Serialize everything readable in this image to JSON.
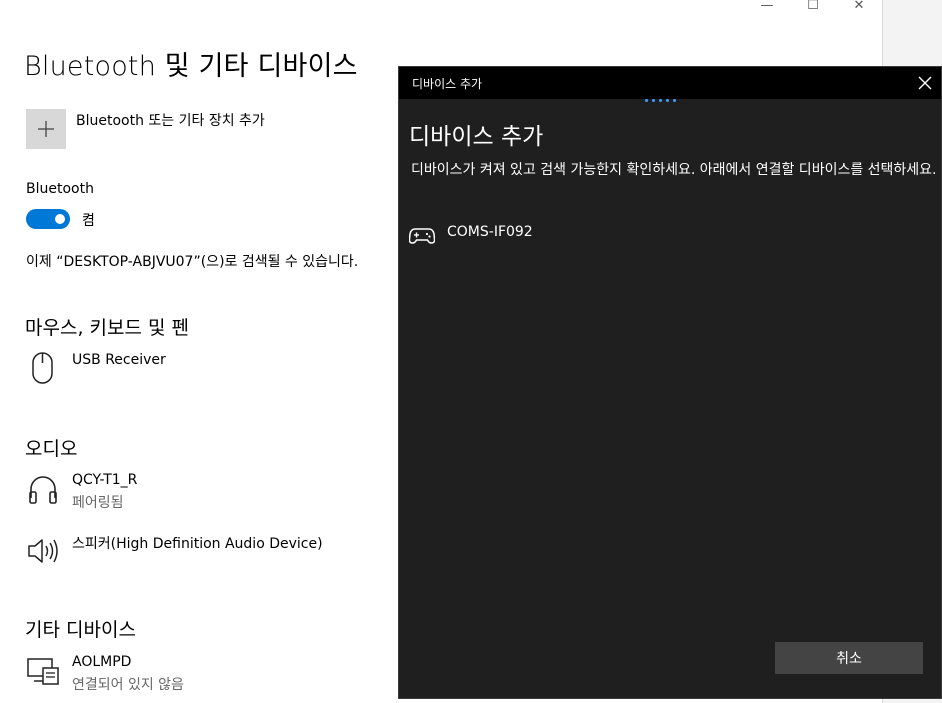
{
  "window": {
    "minimize_glyph": "—",
    "maximize_glyph": "☐",
    "close_glyph": "✕"
  },
  "settings": {
    "title": "Bluetooth 및 기타 디바이스",
    "add_device_label": "Bluetooth 또는 기타 장치 추가",
    "bluetooth_section": "Bluetooth",
    "toggle_state": "켬",
    "discoverable_text": "이제 “DESKTOP-ABJVU07”(으)로 검색될 수 있습니다.",
    "sections": {
      "input": {
        "heading": "마우스, 키보드 및 펜",
        "devices": [
          {
            "name": "USB Receiver",
            "icon": "mouse-icon"
          }
        ]
      },
      "audio": {
        "heading": "오디오",
        "devices": [
          {
            "name": "QCY-T1_R",
            "status": "페어링됨",
            "icon": "headphones-icon"
          },
          {
            "name": "스피커(High Definition Audio Device)",
            "icon": "speaker-icon"
          }
        ]
      },
      "other": {
        "heading": "기타 디바이스",
        "devices": [
          {
            "name": "AOLMPD",
            "status": "연결되어 있지 않음",
            "icon": "display-icon"
          }
        ]
      }
    }
  },
  "dialog": {
    "window_title": "디바이스 추가",
    "heading": "디바이스 추가",
    "description": "디바이스가 켜져 있고 검색 가능한지 확인하세요. 아래에서 연결할 디바이스를 선택하세요.",
    "devices": [
      {
        "name": "COMS-IF092",
        "icon": "gamepad-icon"
      }
    ],
    "cancel_label": "취소"
  },
  "colors": {
    "accent": "#0078d7",
    "dialog_bg": "#1f1f1f",
    "dialog_titlebar": "#000000",
    "button_bg": "#444444"
  }
}
